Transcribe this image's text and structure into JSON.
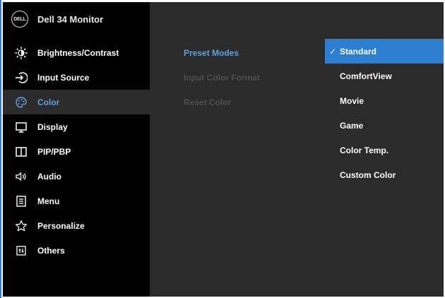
{
  "header": {
    "logo_text": "DELL",
    "title": "Dell 34 Monitor"
  },
  "menu": {
    "items": [
      {
        "label": "Brightness/Contrast",
        "icon": "brightness-icon"
      },
      {
        "label": "Input Source",
        "icon": "input-source-icon"
      },
      {
        "label": "Color",
        "icon": "color-palette-icon",
        "selected": true
      },
      {
        "label": "Display",
        "icon": "display-icon"
      },
      {
        "label": "PIP/PBP",
        "icon": "pip-pbp-icon"
      },
      {
        "label": "Audio",
        "icon": "speaker-icon"
      },
      {
        "label": "Menu",
        "icon": "menu-list-icon"
      },
      {
        "label": "Personalize",
        "icon": "star-icon"
      },
      {
        "label": "Others",
        "icon": "others-icon"
      }
    ]
  },
  "submenu": {
    "items": [
      {
        "label": "Preset Modes",
        "state": "active"
      },
      {
        "label": "Input Color Format",
        "state": "disabled"
      },
      {
        "label": "Reset Color",
        "state": "disabled"
      }
    ]
  },
  "options": {
    "check_mark": "✓",
    "items": [
      {
        "label": "Standard",
        "selected": true
      },
      {
        "label": "ComfortView"
      },
      {
        "label": "Movie"
      },
      {
        "label": "Game"
      },
      {
        "label": "Color Temp."
      },
      {
        "label": "Custom Color"
      }
    ]
  },
  "colors": {
    "accent": "#2c7fd0",
    "highlight_text": "#5aa4e8",
    "panel_bg": "#2b2b2b",
    "sidebar_bg": "#000000"
  }
}
